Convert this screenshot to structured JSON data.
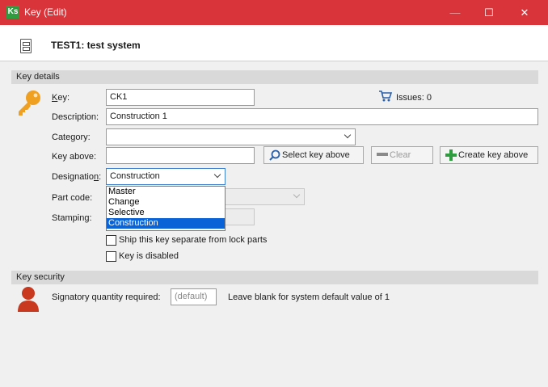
{
  "window": {
    "title": "Key (Edit)",
    "app_icon_text": "Ks",
    "minimize_symbol": "—",
    "maximize_symbol": "☐",
    "close_symbol": "✕"
  },
  "header": {
    "title": "TEST1: test system",
    "icon": "cabinet-icon"
  },
  "key_details": {
    "section_title": "Key details",
    "key_label_letter": "K",
    "key_label_rest": "ey:",
    "key_value": "CK1",
    "issues_label": "Issues: 0",
    "description_label": "Description:",
    "description_value": "Construction 1",
    "category_label": "Category:",
    "category_value": "",
    "key_above_label": "Key above:",
    "key_above_value": "",
    "select_key_above_button": "Select key above",
    "clear_button": "Clear",
    "create_key_above_button": "Create key above",
    "designation_label_pre": "Designatio",
    "designation_label_u": "n",
    "designation_label_post": ":",
    "designation_value": "Construction",
    "designation_options": [
      "Master",
      "Change",
      "Selective",
      "Construction"
    ],
    "designation_selected_index": 3,
    "part_code_label": "Part code:",
    "stamping_label": "Stamping:",
    "ship_separately_label": "Ship this key separate from lock parts",
    "ship_separately_checked": false,
    "disabled_label": "Key is disabled",
    "disabled_checked": false
  },
  "key_security": {
    "section_title": "Key security",
    "signatory_label": "Signatory quantity required:",
    "signatory_placeholder": "(default)",
    "signatory_hint": "Leave blank for system default value of 1"
  },
  "colors": {
    "titlebar": "#d9343a",
    "key_icon": "#f0a020",
    "user_icon": "#c8391f",
    "selection": "#0a64d8",
    "add_icon": "#2e9c3f"
  }
}
